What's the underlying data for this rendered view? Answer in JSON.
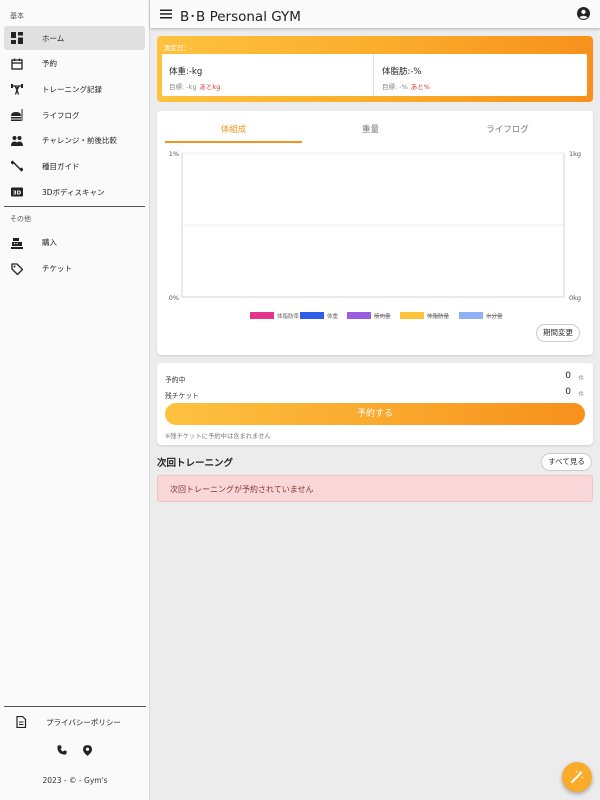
{
  "sidebar": {
    "section_basic": "基本",
    "section_other": "その他",
    "items": [
      {
        "label": "ホーム",
        "icon": "dashboard-icon"
      },
      {
        "label": "予約",
        "icon": "calendar-icon"
      },
      {
        "label": "トレーニング記録",
        "icon": "weightlifting-icon"
      },
      {
        "label": "ライフログ",
        "icon": "meal-icon"
      },
      {
        "label": "チャレンジ・前後比較",
        "icon": "people-icon"
      },
      {
        "label": "種目ガイド",
        "icon": "dumbbell-icon"
      },
      {
        "label": "3Dボディスキャン",
        "icon": "3d-icon"
      }
    ],
    "other_items": [
      {
        "label": "購入",
        "icon": "cash-register-icon"
      },
      {
        "label": "チケット",
        "icon": "tag-icon"
      }
    ],
    "privacy": "プライバシーポリシー",
    "copyright": "2023 - © - Gym's"
  },
  "topbar": {
    "title": "B･B Personal GYM"
  },
  "measure": {
    "date_label": "測定日：-",
    "weight_main": "体重:-kg",
    "weight_goal": "目標: -kg",
    "weight_remaining": "あとkg",
    "fat_main": "体脂肪:-%",
    "fat_goal": "目標: -%",
    "fat_remaining": "あと%"
  },
  "chart": {
    "tabs": [
      "体組成",
      "重量",
      "ライフログ"
    ],
    "active_tab": 0,
    "period_button": "期間変更"
  },
  "chart_data": {
    "type": "line",
    "y_left_ticks": [
      "1%",
      "0%"
    ],
    "y_right_ticks": [
      "1kg",
      "0kg"
    ],
    "ylim_left": [
      0,
      1
    ],
    "ylim_right": [
      0,
      1
    ],
    "grid": true,
    "legend_position": "bottom",
    "series": [
      {
        "name": "体脂肪率",
        "color": "#e3338c",
        "hidden": false,
        "values": []
      },
      {
        "name": "体重",
        "color": "#2f5de6",
        "hidden": false,
        "values": []
      },
      {
        "name": "筋肉量",
        "color": "#9b5ee0",
        "hidden": true,
        "values": []
      },
      {
        "name": "体脂肪量",
        "color": "#fbc23a",
        "hidden": true,
        "values": []
      },
      {
        "name": "水分量",
        "color": "#8fb0f7",
        "hidden": true,
        "values": []
      }
    ]
  },
  "reservation": {
    "reserved_label": "予約中",
    "reserved_count": "0",
    "ticket_label": "残チケット",
    "ticket_count": "0",
    "unit": "件",
    "reserve_button": "予約する",
    "note": "※残チケットに予約中は含まれません"
  },
  "next_training": {
    "title": "次回トレーニング",
    "see_all": "すべて見る",
    "empty_message": "次回トレーニングが予約されていません"
  },
  "colors": {
    "accent": "#f5931e",
    "alert_bg": "#f9d6d8",
    "alert_text": "#843536"
  }
}
